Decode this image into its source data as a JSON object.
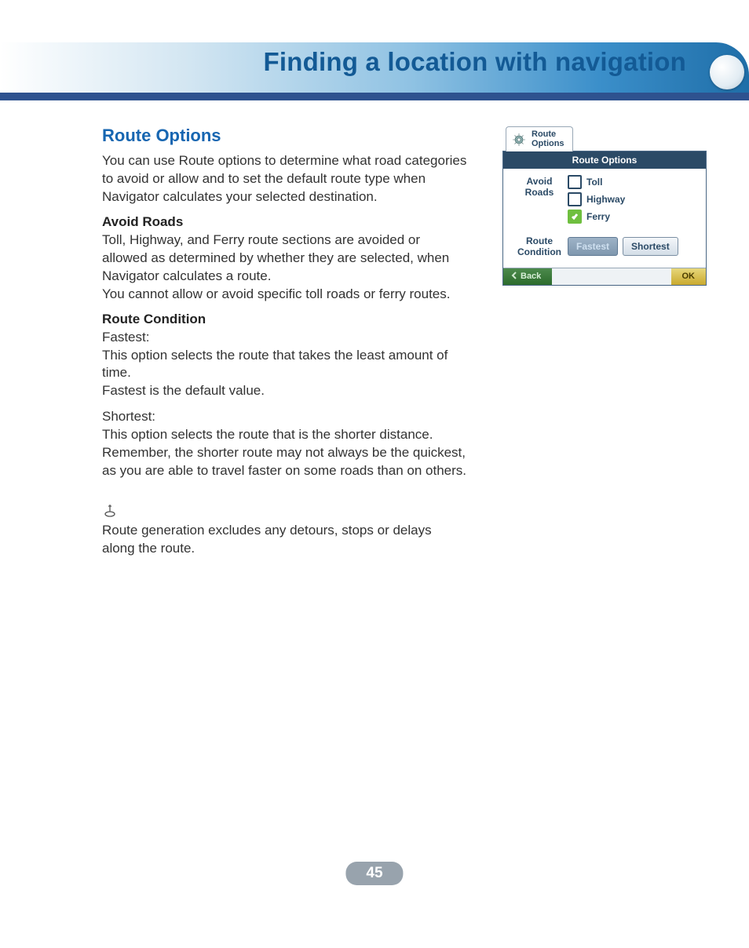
{
  "banner": {
    "title": "Finding a location with navigation"
  },
  "section": {
    "title": "Route Options",
    "intro": "You can use Route options to determine what road categories to avoid or allow and to set the default route type when Navigator calculates your selected destination.",
    "avoid_heading": "Avoid Roads",
    "avoid_para1": "Toll, Highway, and Ferry route sections are avoided or allowed as determined by whether they are selected, when Navigator calculates a route.",
    "avoid_para2": "You cannot allow or avoid specific toll roads or ferry routes.",
    "rc_heading": "Route Condition",
    "fastest_label": "Fastest:",
    "fastest_para1": "This option selects the route that takes the least amount of time.",
    "fastest_para2": "Fastest is the default value.",
    "shortest_label": "Shortest:",
    "shortest_para": "This option selects the route that is the shorter distance. Remember, the shorter route may not always be the quickest, as you are able to travel faster on some roads than on others.",
    "note": "Route generation excludes any detours, stops or delays along the route."
  },
  "screenshot": {
    "tab_line1": "Route",
    "tab_line2": "Options",
    "titlebar": "Route Options",
    "avoid_label": "Avoid Roads",
    "checks": {
      "toll": "Toll",
      "highway": "Highway",
      "ferry": "Ferry"
    },
    "rc_label": "Route Condition",
    "fastest_btn": "Fastest",
    "shortest_btn": "Shortest",
    "back": "Back",
    "ok": "OK"
  },
  "page_number": "45"
}
